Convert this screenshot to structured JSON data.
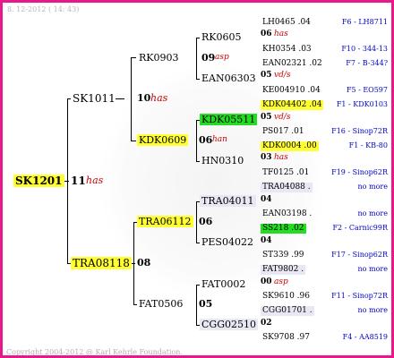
{
  "date": "8. 12-2012 ( 14: 43)",
  "copyright": "Copyright 2004-2012 @ Karl Kehrle Foundation.",
  "root": {
    "id": "SK1201",
    "num": "11",
    "breed": "has"
  },
  "parents": [
    {
      "id": "SK1011",
      "num": "10",
      "breed": "has"
    },
    {
      "id": "TRA08118",
      "num": "08",
      "breed": ""
    }
  ],
  "grandparents": [
    {
      "id": "RK0903",
      "num": "09",
      "breed": "asp"
    },
    {
      "id": "KDK0609",
      "num": "06",
      "breed": "han"
    },
    {
      "id": "TRA06112",
      "num": "06",
      "breed": ""
    },
    {
      "id": "FAT0506",
      "num": "05",
      "breed": ""
    }
  ],
  "ggp": [
    {
      "id": "RK0605",
      "num": "06",
      "breed": "has"
    },
    {
      "id": "EAN06303",
      "num": "05",
      "breed": "vd/s"
    },
    {
      "id": "KDK05511",
      "num": "05",
      "breed": "vd/s"
    },
    {
      "id": "HN0310",
      "num": "03",
      "breed": "has"
    },
    {
      "id": "TRA04011",
      "num": "04",
      "breed": ""
    },
    {
      "id": "PES04022",
      "num": "04",
      "breed": ""
    },
    {
      "id": "FAT0002",
      "num": "00",
      "breed": "asp"
    },
    {
      "id": "CGG02510",
      "num": "02",
      "breed": ""
    }
  ],
  "level4": [
    {
      "id": "LH0465 .04",
      "side": "F6 - LH8711"
    },
    {
      "id": "KH0354 .03",
      "side": "F10 - 344-13"
    },
    {
      "id": "EAN02321 .02",
      "side": "F7 - B-344?"
    },
    {
      "id": "KE004910 .04",
      "side": "F5 - EO597"
    },
    {
      "id": "KDK04402 .04",
      "side": "F1 - KDK0103"
    },
    {
      "id": "PS017 .01",
      "side": "F16 - Sinop72R"
    },
    {
      "id": "KDK0004 .00",
      "side": "F1 - KB-80"
    },
    {
      "id": "TF0125 .01",
      "side": "F19 - Sinop62R"
    },
    {
      "id": "TRA04088 .",
      "side": "no more"
    },
    {
      "id": "EAN03198 .",
      "side": "no more"
    },
    {
      "id": "SS218 .02",
      "side": "F2 - Carnic99R"
    },
    {
      "id": "ST339 .99",
      "side": "F17 - Sinop62R"
    },
    {
      "id": "FAT9802 .",
      "side": "no more"
    },
    {
      "id": "SK9610 .96",
      "side": "F11 - Sinop72R"
    },
    {
      "id": "CGG01701 .",
      "side": "no more"
    },
    {
      "id": "SK9708 .97",
      "side": "F4 - AA8519"
    }
  ]
}
